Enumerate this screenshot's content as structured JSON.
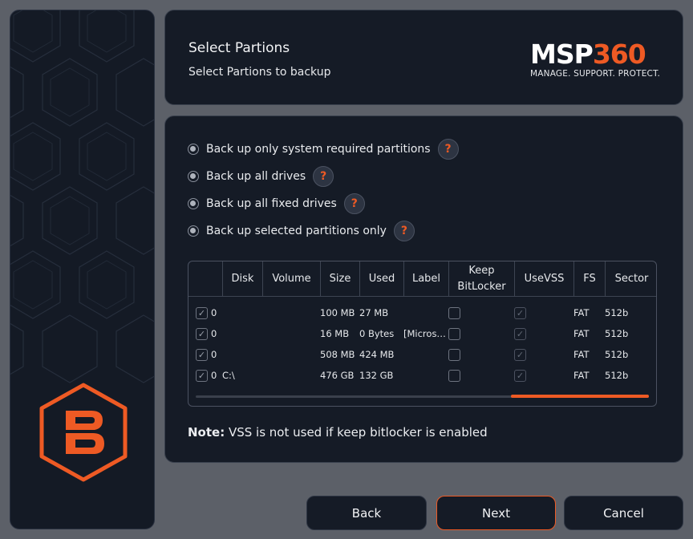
{
  "header": {
    "title": "Select Partions",
    "subtitle": "Select Partions to backup"
  },
  "brand": {
    "name_part1": "MSP",
    "name_part2": "360",
    "tagline": "MANAGE. SUPPORT. PROTECT.",
    "accent_color": "#ee5a24"
  },
  "options": [
    {
      "label": "Back up only system required partitions",
      "help": "?"
    },
    {
      "label": "Back up all drives",
      "help": "?"
    },
    {
      "label": "Back up all fixed drives",
      "help": "?"
    },
    {
      "label": "Back up selected partitions only",
      "help": "?"
    }
  ],
  "table": {
    "columns": [
      "Disk",
      "Volume",
      "Size",
      "Used",
      "Label",
      "Keep BitLocker",
      "UseVSS",
      "FS",
      "Sector"
    ],
    "rows": [
      {
        "selected": true,
        "disk": "0",
        "volume": "",
        "size": "100 MB",
        "used": "27 MB",
        "label": "",
        "keep_bitlocker": false,
        "use_vss": true,
        "fs": "FAT",
        "sector": "512b"
      },
      {
        "selected": true,
        "disk": "0",
        "volume": "",
        "size": "16 MB",
        "used": "0 Bytes",
        "label": "[Micros…",
        "keep_bitlocker": false,
        "use_vss": true,
        "fs": "FAT",
        "sector": "512b"
      },
      {
        "selected": true,
        "disk": "0",
        "volume": "",
        "size": "508 MB",
        "used": "424 MB",
        "label": "",
        "keep_bitlocker": false,
        "use_vss": true,
        "fs": "FAT",
        "sector": "512b"
      },
      {
        "selected": true,
        "disk": "0",
        "volume": "C:\\",
        "size": "476 GB",
        "used": "132 GB",
        "label": "",
        "keep_bitlocker": false,
        "use_vss": true,
        "fs": "FAT",
        "sector": "512b"
      }
    ]
  },
  "note": {
    "prefix": "Note:",
    "text": " VSS is not used if keep bitlocker is enabled"
  },
  "buttons": {
    "back": "Back",
    "next": "Next",
    "cancel": "Cancel"
  },
  "icons": {
    "help": "question-icon",
    "check": "checkmark-icon",
    "logo": "hexagon-b-logo-icon"
  }
}
